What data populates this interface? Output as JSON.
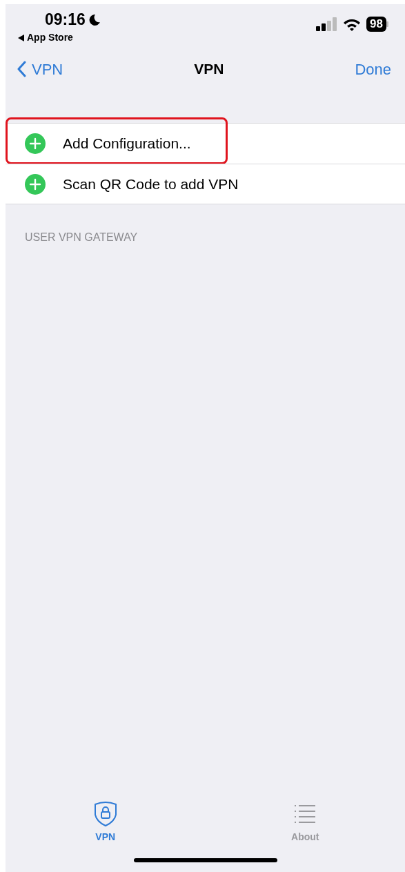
{
  "status_bar": {
    "time": "09:16",
    "back_app": "App Store",
    "battery": "98"
  },
  "nav_bar": {
    "back_label": "VPN",
    "title": "VPN",
    "action": "Done"
  },
  "rows": [
    {
      "label": "Add Configuration...",
      "highlighted": true
    },
    {
      "label": "Scan QR Code to add VPN",
      "highlighted": false
    }
  ],
  "section_header": "USER VPN GATEWAY",
  "tabs": [
    {
      "label": "VPN",
      "kind": "shield",
      "selected": true
    },
    {
      "label": "About",
      "kind": "list",
      "selected": false
    }
  ]
}
